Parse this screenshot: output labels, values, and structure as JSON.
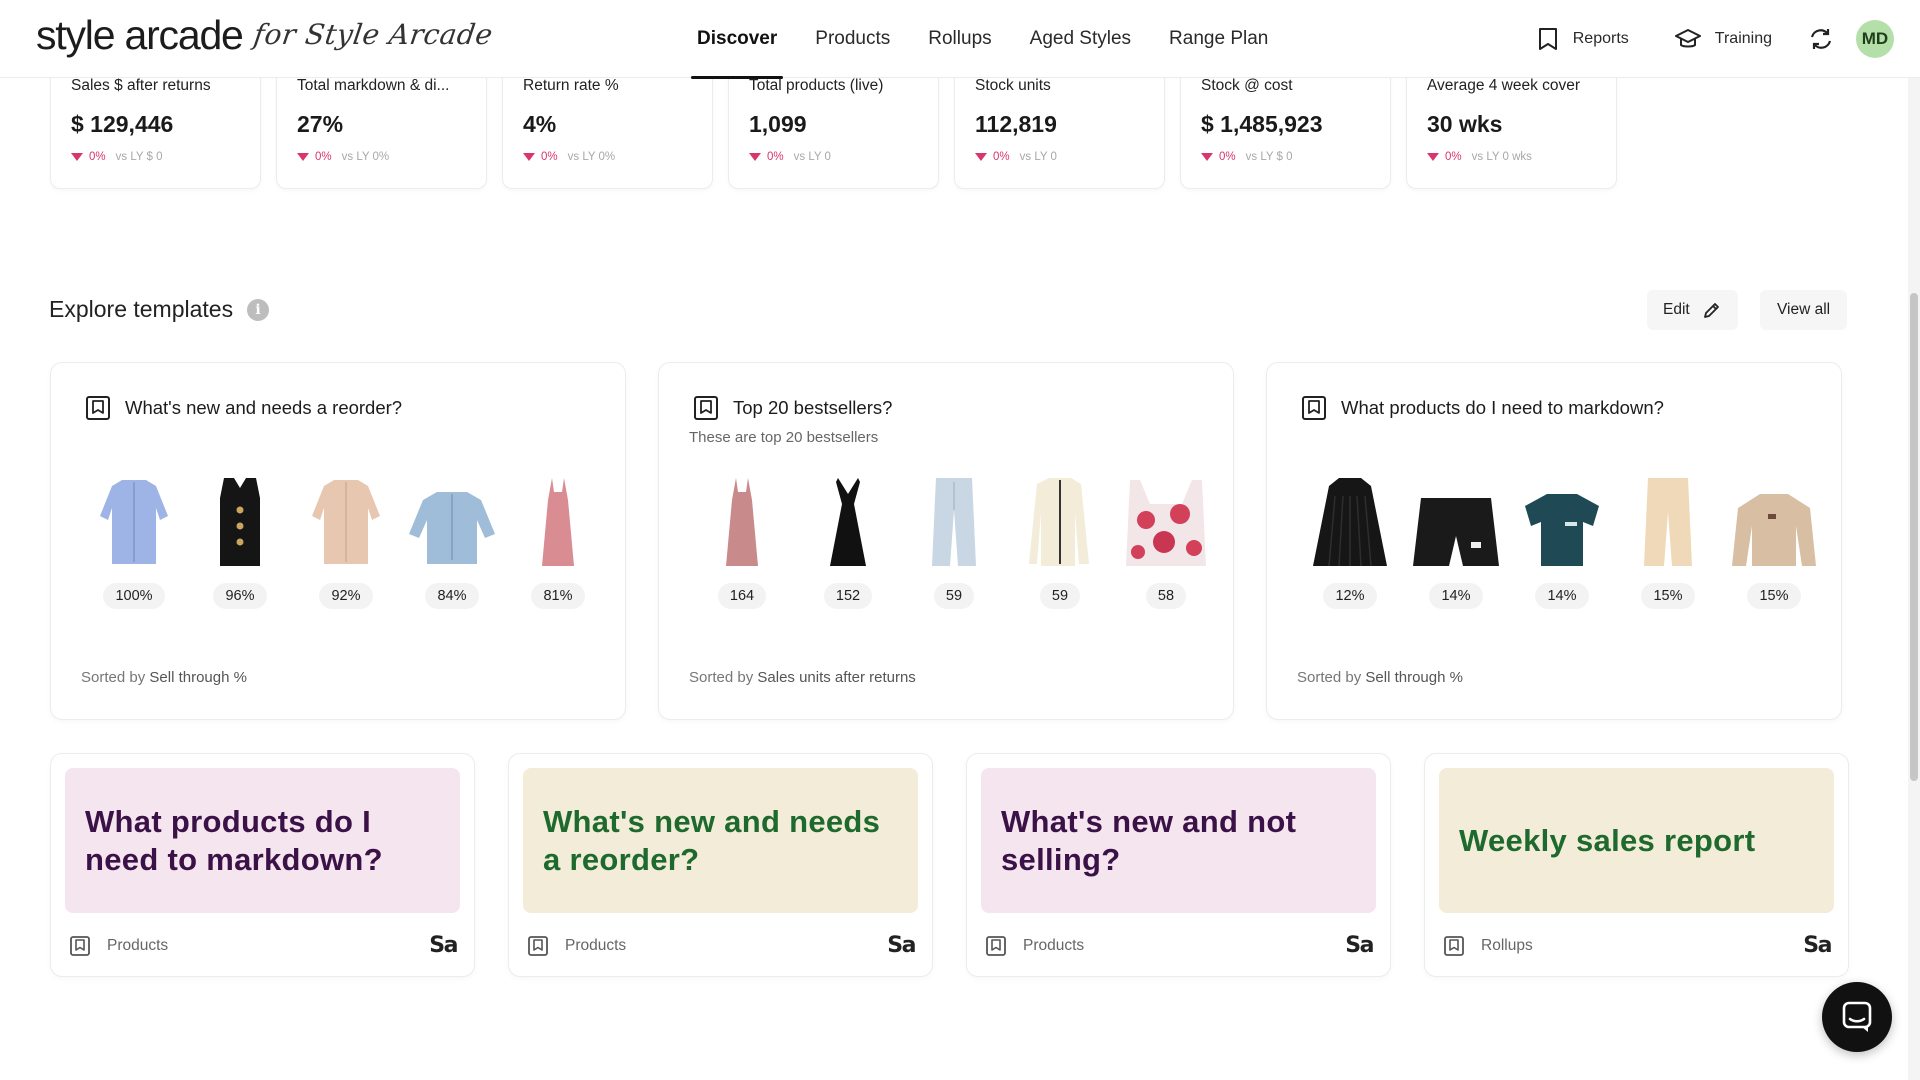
{
  "brand": {
    "name": "style arcade",
    "tagline": "for Style Arcade"
  },
  "nav": {
    "tabs": [
      {
        "label": "Discover",
        "active": true
      },
      {
        "label": "Products",
        "active": false
      },
      {
        "label": "Rollups",
        "active": false
      },
      {
        "label": "Aged Styles",
        "active": false
      },
      {
        "label": "Range Plan",
        "active": false
      }
    ],
    "reports_label": "Reports",
    "training_label": "Training",
    "avatar_initials": "MD"
  },
  "kpis": [
    {
      "label": "Sales $ after returns",
      "value": "$ 129,446",
      "delta": "0%",
      "ly": "vs LY $ 0"
    },
    {
      "label": "Total markdown & di...",
      "value": "27%",
      "delta": "0%",
      "ly": "vs LY 0%"
    },
    {
      "label": "Return rate %",
      "value": "4%",
      "delta": "0%",
      "ly": "vs LY 0%"
    },
    {
      "label": "Total products (live)",
      "value": "1,099",
      "delta": "0%",
      "ly": "vs LY 0"
    },
    {
      "label": "Stock units",
      "value": "112,819",
      "delta": "0%",
      "ly": "vs LY 0"
    },
    {
      "label": "Stock @ cost",
      "value": "$ 1,485,923",
      "delta": "0%",
      "ly": "vs LY $ 0"
    },
    {
      "label": "Average 4 week cover",
      "value": "30 wks",
      "delta": "0%",
      "ly": "vs LY 0 wks"
    }
  ],
  "explore": {
    "title": "Explore templates",
    "edit_label": "Edit",
    "view_all_label": "View all"
  },
  "templates": [
    {
      "title": "What's new and needs a reorder?",
      "subtitle": "",
      "sort_prefix": "Sorted by",
      "sort_field": "Sell through %",
      "products": [
        {
          "kind": "shirt",
          "color": "#9fb4e6",
          "value": "100%"
        },
        {
          "kind": "vest",
          "color": "#151515",
          "value": "96%"
        },
        {
          "kind": "shirt",
          "color": "#e8c7b0",
          "value": "92%"
        },
        {
          "kind": "denim-shirt",
          "color": "#9fbcd8",
          "value": "84%"
        },
        {
          "kind": "slip-dress",
          "color": "#d98d93",
          "value": "81%"
        }
      ]
    },
    {
      "title": "Top 20 bestsellers?",
      "subtitle": "These are top 20 bestsellers",
      "sort_prefix": "Sorted by",
      "sort_field": "Sales units after returns",
      "products": [
        {
          "kind": "slip-dress",
          "color": "#c98a8c",
          "value": "164"
        },
        {
          "kind": "halter-dress",
          "color": "#111111",
          "value": "152"
        },
        {
          "kind": "jeans",
          "color": "#c9d6e3",
          "value": "59"
        },
        {
          "kind": "jacket",
          "color": "#f2ecd9",
          "value": "59"
        },
        {
          "kind": "floral-top",
          "color": "#d2405a",
          "value": "58"
        }
      ]
    },
    {
      "title": "What products do I need to markdown?",
      "subtitle": "",
      "sort_prefix": "Sorted by",
      "sort_field": "Sell through %",
      "products": [
        {
          "kind": "pleated-top",
          "color": "#161616",
          "value": "12%"
        },
        {
          "kind": "shorts",
          "color": "#1a1a1a",
          "value": "14%"
        },
        {
          "kind": "tshirt",
          "color": "#1f4a55",
          "value": "14%"
        },
        {
          "kind": "pants",
          "color": "#efd9b9",
          "value": "15%"
        },
        {
          "kind": "sweater",
          "color": "#d8bfa3",
          "value": "15%"
        }
      ]
    }
  ],
  "reports": [
    {
      "title": "What products do I need to markdown?",
      "category": "Products",
      "bg": "#f5e5ef",
      "fg": "#3b1247"
    },
    {
      "title": "What's new and needs a reorder?",
      "category": "Products",
      "bg": "#f3ecd9",
      "fg": "#1e6a2e"
    },
    {
      "title": "What's new and not selling?",
      "category": "Products",
      "bg": "#f5e5ef",
      "fg": "#3b1247"
    },
    {
      "title": "Weekly sales report",
      "category": "Rollups",
      "bg": "#f3ecd9",
      "fg": "#1e6a2e"
    }
  ],
  "sa_mark": "Sa",
  "colors": {
    "accent": "#111111",
    "delta_negative": "#d8376a",
    "avatar": "#b5dfa9"
  }
}
